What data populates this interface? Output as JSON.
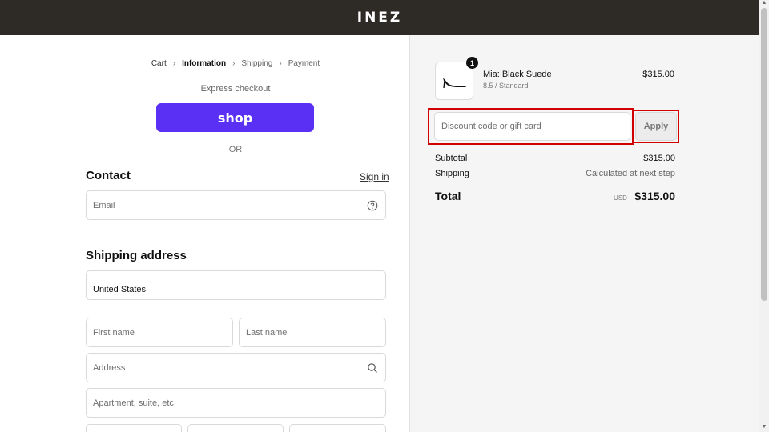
{
  "header": {
    "logo": "INEZ"
  },
  "breadcrumb": {
    "items": [
      {
        "label": "Cart",
        "state": "done"
      },
      {
        "label": "Information",
        "state": "current"
      },
      {
        "label": "Shipping",
        "state": "upcoming"
      },
      {
        "label": "Payment",
        "state": "upcoming"
      }
    ],
    "separator": "›"
  },
  "express": {
    "label": "Express checkout",
    "shop_button": "shop"
  },
  "divider": {
    "or_label": "OR"
  },
  "contact": {
    "title": "Contact",
    "sign_in": "Sign in",
    "email_placeholder": "Email"
  },
  "shipping": {
    "title": "Shipping address",
    "country": "United States",
    "first_name_placeholder": "First name",
    "last_name_placeholder": "Last name",
    "address_placeholder": "Address",
    "apartment_placeholder": "Apartment, suite, etc."
  },
  "order": {
    "quantity": "1",
    "product_name": "Mia: Black Suede",
    "product_variant": "8.5 / Standard",
    "product_price": "$315.00",
    "discount_placeholder": "Discount code or gift card",
    "apply_label": "Apply",
    "subtotal_label": "Subtotal",
    "subtotal_value": "$315.00",
    "shipping_label": "Shipping",
    "shipping_value": "Calculated at next step",
    "total_label": "Total",
    "total_currency": "USD",
    "total_value": "$315.00"
  },
  "colors": {
    "header_bg": "#2e2b27",
    "shop_purple": "#5a31f4",
    "highlight_red": "#d10000",
    "summary_bg": "#f5f5f5"
  },
  "icons": {
    "email_help": "question-circle-icon",
    "address_search": "search-icon",
    "product": "black-heel-shoe-icon"
  }
}
